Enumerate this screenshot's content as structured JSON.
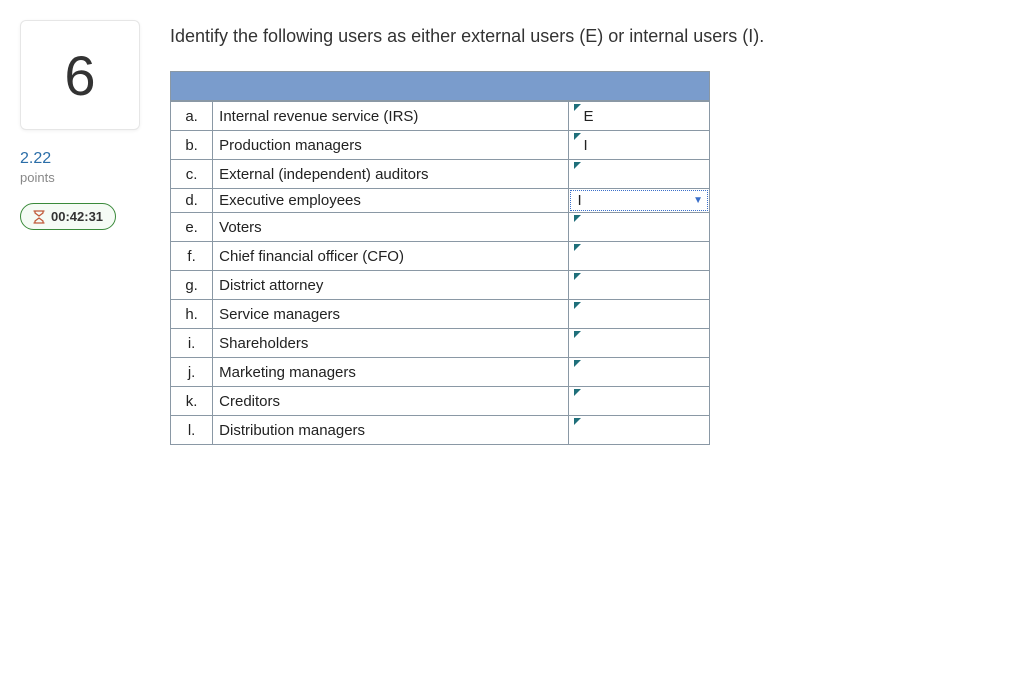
{
  "sidebar": {
    "question_number": "6",
    "points_value": "2.22",
    "points_label": "points",
    "timer": "00:42:31"
  },
  "question": {
    "prompt": "Identify the following users as either external users (E) or internal users (I)."
  },
  "rows": [
    {
      "letter": "a.",
      "desc": "Internal revenue service (IRS)",
      "answer": "E",
      "state": "filled"
    },
    {
      "letter": "b.",
      "desc": "Production managers",
      "answer": "I",
      "state": "filled"
    },
    {
      "letter": "c.",
      "desc": "External (independent) auditors",
      "answer": "",
      "state": "empty"
    },
    {
      "letter": "d.",
      "desc": "Executive employees",
      "answer": "I",
      "state": "active"
    },
    {
      "letter": "e.",
      "desc": "Voters",
      "answer": "",
      "state": "empty"
    },
    {
      "letter": "f.",
      "desc": "Chief financial officer (CFO)",
      "answer": "",
      "state": "empty"
    },
    {
      "letter": "g.",
      "desc": "District attorney",
      "answer": "",
      "state": "empty"
    },
    {
      "letter": "h.",
      "desc": "Service managers",
      "answer": "",
      "state": "empty"
    },
    {
      "letter": "i.",
      "desc": "Shareholders",
      "answer": "",
      "state": "empty"
    },
    {
      "letter": "j.",
      "desc": "Marketing managers",
      "answer": "",
      "state": "empty"
    },
    {
      "letter": "k.",
      "desc": "Creditors",
      "answer": "",
      "state": "empty"
    },
    {
      "letter": "l.",
      "desc": "Distribution managers",
      "answer": "",
      "state": "empty"
    }
  ]
}
